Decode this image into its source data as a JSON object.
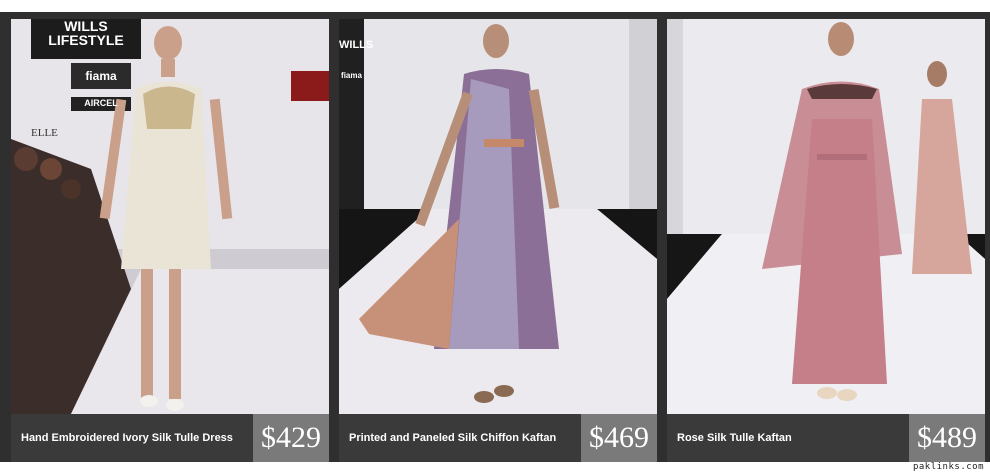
{
  "products": [
    {
      "name": "Hand Embroidered Ivory Silk Tulle Dress",
      "price": "$429",
      "logos": [
        "WILLS LIFESTYLE",
        "fiama",
        "AIRCEL",
        "ELLE"
      ]
    },
    {
      "name": "Printed and Paneled Silk Chiffon Kaftan",
      "price": "$469",
      "logos": [
        "WILLS",
        "fiama"
      ]
    },
    {
      "name": "Rose Silk Tulle Kaftan",
      "price": "$489",
      "logos": []
    }
  ],
  "watermark": "paklinks.com"
}
